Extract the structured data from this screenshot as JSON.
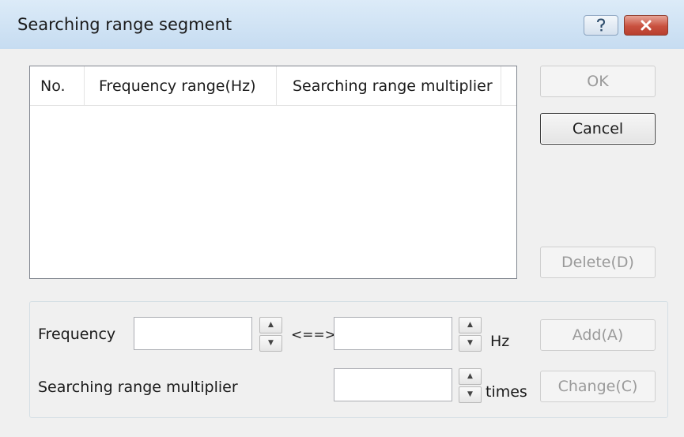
{
  "window": {
    "title": "Searching range segment",
    "help_icon": "help-question-icon",
    "close_icon": "close-x-icon",
    "close_color": "#c9513f"
  },
  "list": {
    "columns": [
      "No.",
      "Frequency range(Hz)",
      "Searching range multiplier"
    ],
    "rows": []
  },
  "buttons": {
    "ok": "OK",
    "cancel": "Cancel",
    "delete": "Delete(D)",
    "add": "Add(A)",
    "change": "Change(C)"
  },
  "form": {
    "frequency_label": "Frequency",
    "frequency_from": "",
    "frequency_to": "",
    "range_symbol": "<==>",
    "hz_unit": "Hz",
    "multiplier_label": "Searching range multiplier",
    "multiplier_value": "",
    "times_unit": "times"
  }
}
